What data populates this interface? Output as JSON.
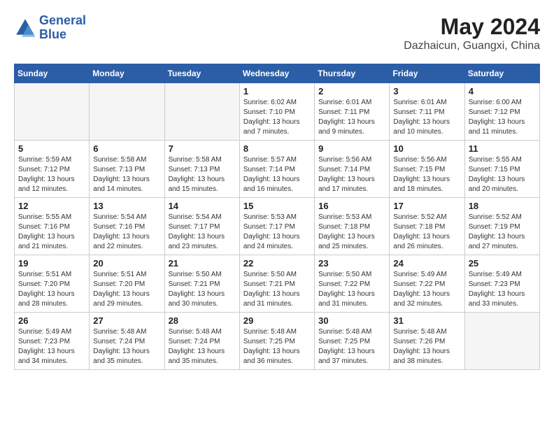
{
  "header": {
    "logo_line1": "General",
    "logo_line2": "Blue",
    "month_title": "May 2024",
    "location": "Dazhaicun, Guangxi, China"
  },
  "weekdays": [
    "Sunday",
    "Monday",
    "Tuesday",
    "Wednesday",
    "Thursday",
    "Friday",
    "Saturday"
  ],
  "weeks": [
    [
      {
        "day": "",
        "info": ""
      },
      {
        "day": "",
        "info": ""
      },
      {
        "day": "",
        "info": ""
      },
      {
        "day": "1",
        "info": "Sunrise: 6:02 AM\nSunset: 7:10 PM\nDaylight: 13 hours\nand 7 minutes."
      },
      {
        "day": "2",
        "info": "Sunrise: 6:01 AM\nSunset: 7:11 PM\nDaylight: 13 hours\nand 9 minutes."
      },
      {
        "day": "3",
        "info": "Sunrise: 6:01 AM\nSunset: 7:11 PM\nDaylight: 13 hours\nand 10 minutes."
      },
      {
        "day": "4",
        "info": "Sunrise: 6:00 AM\nSunset: 7:12 PM\nDaylight: 13 hours\nand 11 minutes."
      }
    ],
    [
      {
        "day": "5",
        "info": "Sunrise: 5:59 AM\nSunset: 7:12 PM\nDaylight: 13 hours\nand 12 minutes."
      },
      {
        "day": "6",
        "info": "Sunrise: 5:58 AM\nSunset: 7:13 PM\nDaylight: 13 hours\nand 14 minutes."
      },
      {
        "day": "7",
        "info": "Sunrise: 5:58 AM\nSunset: 7:13 PM\nDaylight: 13 hours\nand 15 minutes."
      },
      {
        "day": "8",
        "info": "Sunrise: 5:57 AM\nSunset: 7:14 PM\nDaylight: 13 hours\nand 16 minutes."
      },
      {
        "day": "9",
        "info": "Sunrise: 5:56 AM\nSunset: 7:14 PM\nDaylight: 13 hours\nand 17 minutes."
      },
      {
        "day": "10",
        "info": "Sunrise: 5:56 AM\nSunset: 7:15 PM\nDaylight: 13 hours\nand 18 minutes."
      },
      {
        "day": "11",
        "info": "Sunrise: 5:55 AM\nSunset: 7:15 PM\nDaylight: 13 hours\nand 20 minutes."
      }
    ],
    [
      {
        "day": "12",
        "info": "Sunrise: 5:55 AM\nSunset: 7:16 PM\nDaylight: 13 hours\nand 21 minutes."
      },
      {
        "day": "13",
        "info": "Sunrise: 5:54 AM\nSunset: 7:16 PM\nDaylight: 13 hours\nand 22 minutes."
      },
      {
        "day": "14",
        "info": "Sunrise: 5:54 AM\nSunset: 7:17 PM\nDaylight: 13 hours\nand 23 minutes."
      },
      {
        "day": "15",
        "info": "Sunrise: 5:53 AM\nSunset: 7:17 PM\nDaylight: 13 hours\nand 24 minutes."
      },
      {
        "day": "16",
        "info": "Sunrise: 5:53 AM\nSunset: 7:18 PM\nDaylight: 13 hours\nand 25 minutes."
      },
      {
        "day": "17",
        "info": "Sunrise: 5:52 AM\nSunset: 7:18 PM\nDaylight: 13 hours\nand 26 minutes."
      },
      {
        "day": "18",
        "info": "Sunrise: 5:52 AM\nSunset: 7:19 PM\nDaylight: 13 hours\nand 27 minutes."
      }
    ],
    [
      {
        "day": "19",
        "info": "Sunrise: 5:51 AM\nSunset: 7:20 PM\nDaylight: 13 hours\nand 28 minutes."
      },
      {
        "day": "20",
        "info": "Sunrise: 5:51 AM\nSunset: 7:20 PM\nDaylight: 13 hours\nand 29 minutes."
      },
      {
        "day": "21",
        "info": "Sunrise: 5:50 AM\nSunset: 7:21 PM\nDaylight: 13 hours\nand 30 minutes."
      },
      {
        "day": "22",
        "info": "Sunrise: 5:50 AM\nSunset: 7:21 PM\nDaylight: 13 hours\nand 31 minutes."
      },
      {
        "day": "23",
        "info": "Sunrise: 5:50 AM\nSunset: 7:22 PM\nDaylight: 13 hours\nand 31 minutes."
      },
      {
        "day": "24",
        "info": "Sunrise: 5:49 AM\nSunset: 7:22 PM\nDaylight: 13 hours\nand 32 minutes."
      },
      {
        "day": "25",
        "info": "Sunrise: 5:49 AM\nSunset: 7:23 PM\nDaylight: 13 hours\nand 33 minutes."
      }
    ],
    [
      {
        "day": "26",
        "info": "Sunrise: 5:49 AM\nSunset: 7:23 PM\nDaylight: 13 hours\nand 34 minutes."
      },
      {
        "day": "27",
        "info": "Sunrise: 5:48 AM\nSunset: 7:24 PM\nDaylight: 13 hours\nand 35 minutes."
      },
      {
        "day": "28",
        "info": "Sunrise: 5:48 AM\nSunset: 7:24 PM\nDaylight: 13 hours\nand 35 minutes."
      },
      {
        "day": "29",
        "info": "Sunrise: 5:48 AM\nSunset: 7:25 PM\nDaylight: 13 hours\nand 36 minutes."
      },
      {
        "day": "30",
        "info": "Sunrise: 5:48 AM\nSunset: 7:25 PM\nDaylight: 13 hours\nand 37 minutes."
      },
      {
        "day": "31",
        "info": "Sunrise: 5:48 AM\nSunset: 7:26 PM\nDaylight: 13 hours\nand 38 minutes."
      },
      {
        "day": "",
        "info": ""
      }
    ]
  ]
}
